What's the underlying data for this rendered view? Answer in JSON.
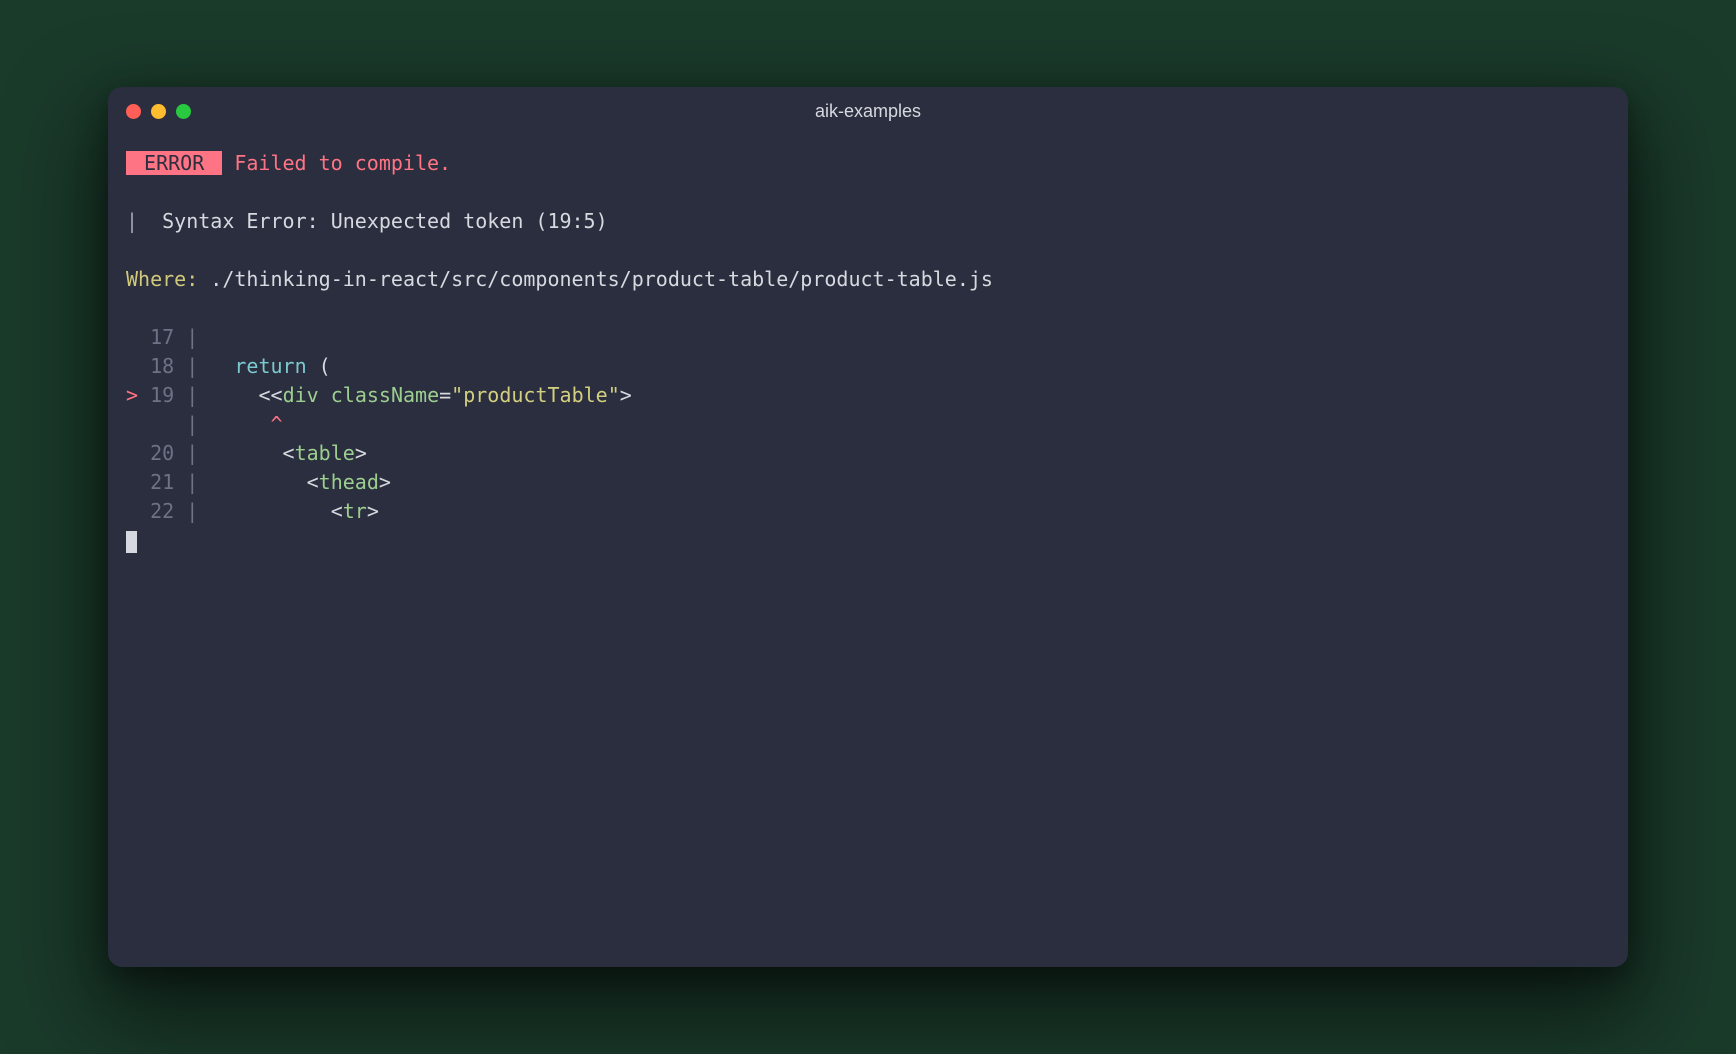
{
  "window": {
    "title": "aik-examples"
  },
  "error": {
    "badge": " ERROR ",
    "message": "Failed to compile.",
    "pipe": "|  ",
    "details": "Syntax Error: Unexpected token (19:5)"
  },
  "where": {
    "label": "Where:",
    "path": " ./thinking-in-react/src/components/product-table/product-table.js"
  },
  "code": {
    "lines": [
      {
        "gutter": "  17 | ",
        "segments": []
      },
      {
        "gutter": "  18 |   ",
        "segments": [
          {
            "cls": "c-cyan",
            "text": "return"
          },
          {
            "cls": "",
            "text": " ("
          }
        ]
      },
      {
        "marker": "> ",
        "gutter": "19 |     ",
        "segments": [
          {
            "cls": "",
            "text": "<<"
          },
          {
            "cls": "c-green",
            "text": "div"
          },
          {
            "cls": "",
            "text": " "
          },
          {
            "cls": "c-green",
            "text": "className"
          },
          {
            "cls": "",
            "text": "="
          },
          {
            "cls": "c-string",
            "text": "\"productTable\""
          },
          {
            "cls": "",
            "text": ">"
          }
        ]
      },
      {
        "gutter": "     |      ",
        "segments": [
          {
            "cls": "c-red",
            "text": "^"
          }
        ]
      },
      {
        "gutter": "  20 |       ",
        "segments": [
          {
            "cls": "",
            "text": "<"
          },
          {
            "cls": "c-green",
            "text": "table"
          },
          {
            "cls": "",
            "text": ">"
          }
        ]
      },
      {
        "gutter": "  21 |         ",
        "segments": [
          {
            "cls": "",
            "text": "<"
          },
          {
            "cls": "c-green",
            "text": "thead"
          },
          {
            "cls": "",
            "text": ">"
          }
        ]
      },
      {
        "gutter": "  22 |           ",
        "segments": [
          {
            "cls": "",
            "text": "<"
          },
          {
            "cls": "c-green",
            "text": "tr"
          },
          {
            "cls": "",
            "text": ">"
          }
        ]
      }
    ]
  }
}
